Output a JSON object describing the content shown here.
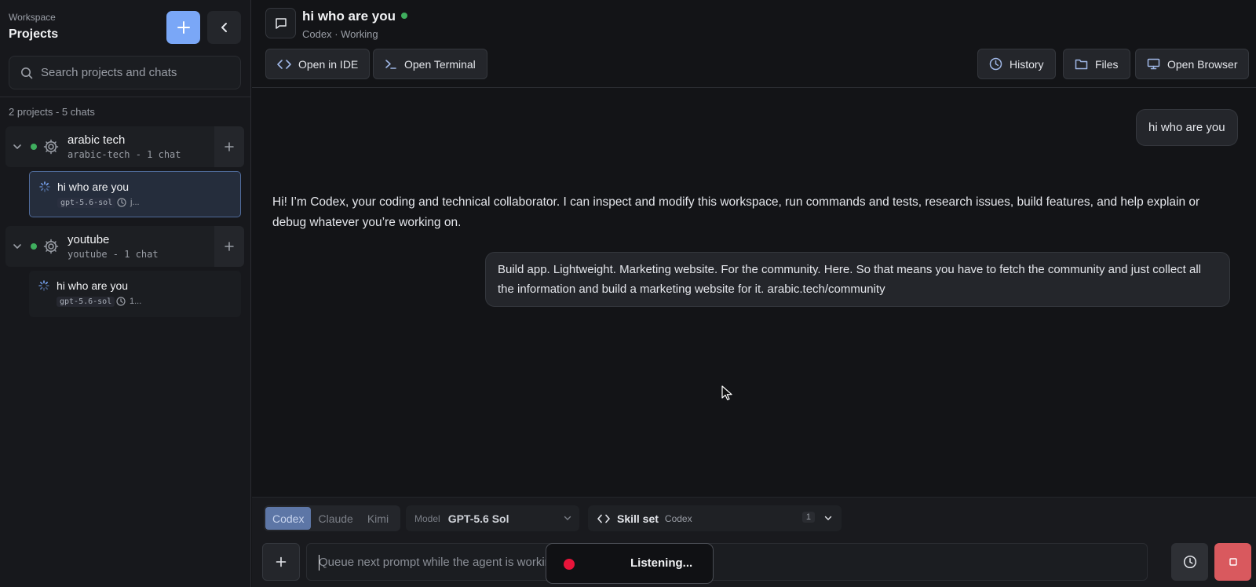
{
  "sidebar": {
    "workspace_label": "Workspace",
    "title": "Projects",
    "search_placeholder": "Search projects and chats",
    "counts": "2 projects - 5 chats",
    "projects": [
      {
        "name": "arabic tech",
        "meta": "arabic-tech - 1 chat",
        "chat": {
          "title": "hi who are you",
          "model": "gpt-5.6-sol",
          "time": "j..."
        }
      },
      {
        "name": "youtube",
        "meta": "youtube - 1 chat",
        "chat": {
          "title": "hi who are you",
          "model": "gpt-5.6-sol",
          "time": "1..."
        }
      }
    ]
  },
  "header": {
    "title": "hi who are you",
    "subtitle": "Codex · Working",
    "toolbar": {
      "open_ide": "Open in IDE",
      "open_terminal": "Open Terminal",
      "history": "History",
      "files": "Files",
      "open_browser": "Open Browser"
    }
  },
  "messages": [
    {
      "role": "user",
      "text": "hi who are you"
    },
    {
      "role": "assistant",
      "text": "Hi! I’m Codex, your coding and technical collaborator. I can inspect and modify this workspace, run commands and tests, research issues, build features, and help explain or debug whatever you’re working on."
    },
    {
      "role": "user",
      "text": "Build app. Lightweight. Marketing website. For the community. Here. So that means you have to fetch the community and just collect all the information and build a marketing website for it. arabic.tech/community"
    }
  ],
  "composer": {
    "agents": [
      "Codex",
      "Claude",
      "Kimi"
    ],
    "active_agent": "Codex",
    "model_label": "Model",
    "model_value": "GPT-5.6 Sol",
    "skill_label": "Skill set",
    "skill_value": "Codex",
    "skill_count": "1",
    "input_placeholder": "Queue next prompt while the agent is working...",
    "listening_text": "Listening..."
  },
  "colors": {
    "accent": "#7aa7f7",
    "status_online": "#3fae5e",
    "record": "#e8143a",
    "stop": "#d9595e"
  }
}
